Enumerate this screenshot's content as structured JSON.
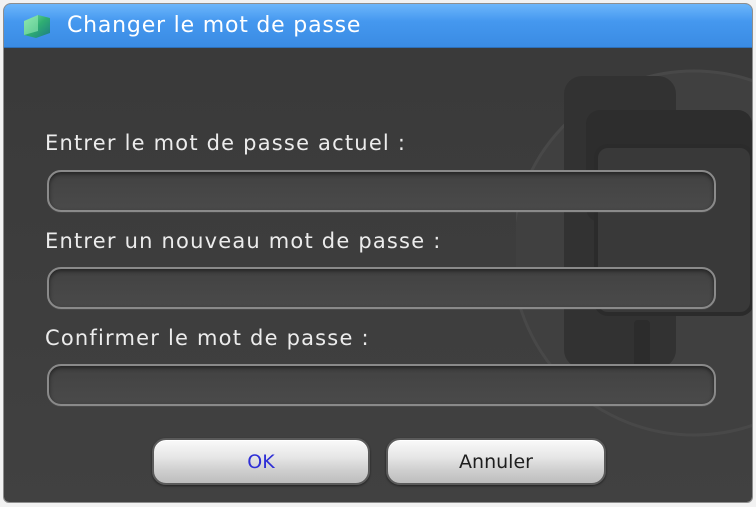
{
  "window": {
    "title": "Changer le mot de passe",
    "icon": "app-leaf-icon",
    "watermark_icon": "device-watermark-icon"
  },
  "form": {
    "fields": [
      {
        "label": "Entrer le mot de passe actuel :",
        "value": ""
      },
      {
        "label": "Entrer un nouveau mot de passe :",
        "value": ""
      },
      {
        "label": "Confirmer le mot de passe :",
        "value": ""
      }
    ]
  },
  "buttons": {
    "ok_label": "OK",
    "cancel_label": "Annuler"
  },
  "colors": {
    "title_bar_top": "#6cb6fb",
    "title_bar": "#4598ef",
    "title_bar_bottom": "#3a8be3",
    "title_text": "#ffffff",
    "body_top": "#393939",
    "body_bottom": "#414141",
    "label_text": "#ececec",
    "ok_text": "#2f2fd6",
    "cancel_text": "#1e1e1e"
  }
}
